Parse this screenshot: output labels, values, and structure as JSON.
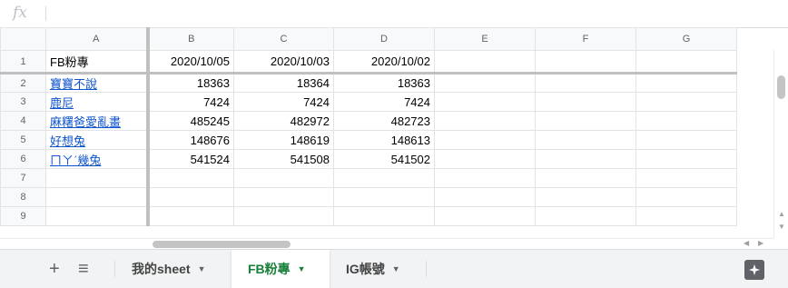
{
  "formula_bar": {
    "fx_label": "fx",
    "value": ""
  },
  "columns": [
    "A",
    "B",
    "C",
    "D",
    "E",
    "F",
    "G"
  ],
  "rows": [
    {
      "num": "1",
      "cells": [
        "FB粉專",
        "2020/10/05",
        "2020/10/03",
        "2020/10/02",
        "",
        "",
        ""
      ]
    },
    {
      "num": "2",
      "cells": [
        "寶寶不說",
        "18363",
        "18364",
        "18363",
        "",
        "",
        ""
      ]
    },
    {
      "num": "3",
      "cells": [
        "鹿尼",
        "7424",
        "7424",
        "7424",
        "",
        "",
        ""
      ]
    },
    {
      "num": "4",
      "cells": [
        "麻糬爸愛亂畫",
        "485245",
        "482972",
        "482723",
        "",
        "",
        ""
      ]
    },
    {
      "num": "5",
      "cells": [
        "好想兔",
        "148676",
        "148619",
        "148613",
        "",
        "",
        ""
      ]
    },
    {
      "num": "6",
      "cells": [
        "ㄇㄚˊ幾兔",
        "541524",
        "541508",
        "541502",
        "",
        "",
        ""
      ]
    },
    {
      "num": "7",
      "cells": [
        "",
        "",
        "",
        "",
        "",
        "",
        ""
      ]
    },
    {
      "num": "8",
      "cells": [
        "",
        "",
        "",
        "",
        "",
        "",
        ""
      ]
    },
    {
      "num": "9",
      "cells": [
        "",
        "",
        "",
        "",
        "",
        "",
        ""
      ]
    }
  ],
  "tabs": [
    {
      "label": "我的sheet",
      "active": false
    },
    {
      "label": "FB粉專",
      "active": true
    },
    {
      "label": "IG帳號",
      "active": false
    }
  ],
  "toolbar": {
    "add_symbol": "+",
    "list_symbol": "≡"
  },
  "colors": {
    "active_tab": "#188038",
    "link": "#1155cc",
    "header_bg": "#f8f9fa"
  }
}
